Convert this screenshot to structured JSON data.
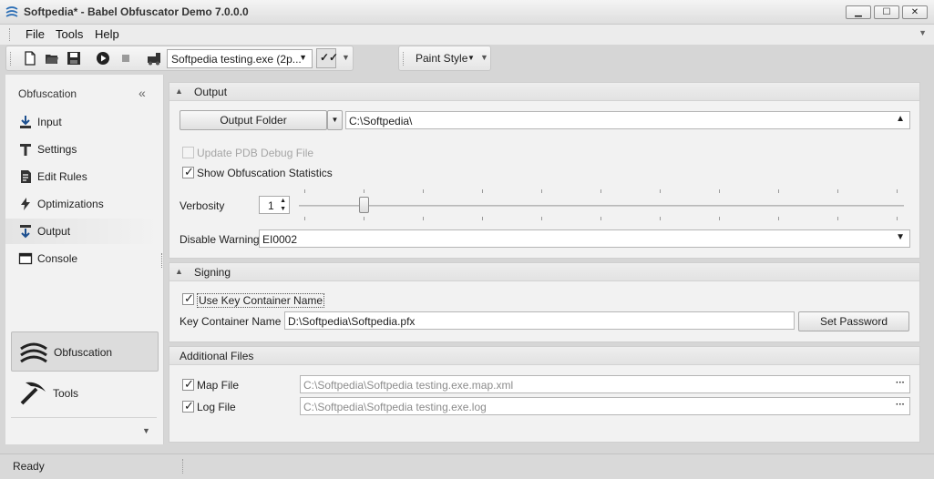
{
  "window": {
    "title": "Softpedia* -  Babel Obfuscator Demo 7.0.0.0",
    "controls": {
      "minimize": "▁",
      "maximize": "☐",
      "close": "✕"
    }
  },
  "menu": {
    "file": "File",
    "tools": "Tools",
    "help": "Help"
  },
  "toolbar": {
    "target_combo": "Softpedia testing.exe (2p...",
    "paint_style": "Paint Style",
    "icons": [
      "new-document-icon",
      "open-folder-icon",
      "save-icon",
      "run-icon",
      "stop-icon",
      "build-icon",
      "check-icon"
    ]
  },
  "sidebar": {
    "title": "Obfuscation",
    "items": [
      {
        "label": "Input",
        "icon": "input-arrow-icon"
      },
      {
        "label": "Settings",
        "icon": "settings-icon"
      },
      {
        "label": "Edit Rules",
        "icon": "edit-rules-icon"
      },
      {
        "label": "Optimizations",
        "icon": "lightning-icon"
      },
      {
        "label": "Output",
        "icon": "output-arrow-icon",
        "active": true
      },
      {
        "label": "Console",
        "icon": "console-icon"
      }
    ],
    "groups": [
      {
        "label": "Obfuscation",
        "icon": "obfuscation-wave-icon",
        "active": true
      },
      {
        "label": "Tools",
        "icon": "pickaxe-icon"
      }
    ]
  },
  "output": {
    "header": "Output",
    "output_folder_button": "Output Folder",
    "output_folder_value": "C:\\Softpedia\\",
    "update_pdb": {
      "label": "Update PDB Debug File",
      "checked": false,
      "enabled": false
    },
    "show_stats": {
      "label": "Show Obfuscation Statistics",
      "checked": true
    },
    "verbosity_label": "Verbosity",
    "verbosity_value": "1",
    "verbosity_level": 1,
    "verbosity_max": 10,
    "disable_warnings_label": "Disable Warnings",
    "disable_warnings_value": "EI0002"
  },
  "signing": {
    "header": "Signing",
    "use_key_container": {
      "label": "Use Key Container Name",
      "checked": true
    },
    "key_container_label": "Key Container Name",
    "key_container_value": "D:\\Softpedia\\Softpedia.pfx",
    "set_password_button": "Set Password"
  },
  "additional_files": {
    "header": "Additional Files",
    "map_file": {
      "label": "Map File",
      "checked": true,
      "value": "C:\\Softpedia\\Softpedia testing.exe.map.xml"
    },
    "log_file": {
      "label": "Log File",
      "checked": true,
      "value": "C:\\Softpedia\\Softpedia testing.exe.log"
    },
    "browse": "···"
  },
  "status": {
    "text": "Ready"
  }
}
